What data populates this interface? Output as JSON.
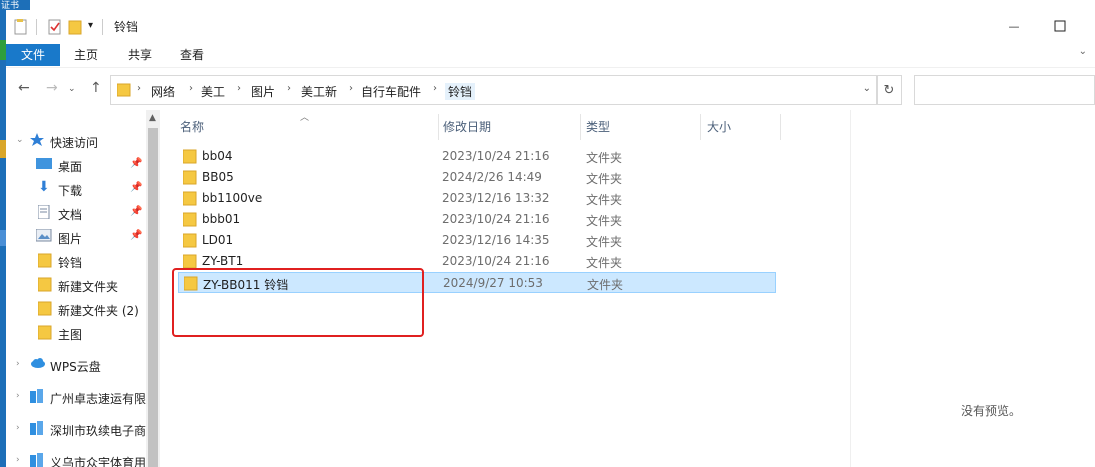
{
  "desktop": {
    "corner_text": "证书"
  },
  "titlebar": {
    "title": "铃铛",
    "maximize_glyph": "☐",
    "minimize_glyph": "—"
  },
  "ribbon": {
    "tabs": [
      {
        "label": "文件",
        "active": true
      },
      {
        "label": "主页",
        "active": false
      },
      {
        "label": "共享",
        "active": false
      },
      {
        "label": "查看",
        "active": false
      }
    ]
  },
  "address": {
    "breadcrumbs": [
      "网络",
      "美工",
      "图片",
      "美工新",
      "自行车配件",
      "铃铛"
    ],
    "search_placeholder": ""
  },
  "nav": {
    "items": [
      {
        "label": "快速访问",
        "icon": "star-icon",
        "pinned": false
      },
      {
        "label": "桌面",
        "icon": "desktop-icon",
        "pinned": true
      },
      {
        "label": "下载",
        "icon": "download-icon",
        "pinned": true
      },
      {
        "label": "文档",
        "icon": "document-icon",
        "pinned": true
      },
      {
        "label": "图片",
        "icon": "pictures-icon",
        "pinned": true
      },
      {
        "label": "铃铛",
        "icon": "folder-icon",
        "pinned": false
      },
      {
        "label": "新建文件夹",
        "icon": "folder-icon",
        "pinned": false
      },
      {
        "label": "新建文件夹 (2)",
        "icon": "folder-icon",
        "pinned": false
      },
      {
        "label": "主图",
        "icon": "folder-icon",
        "pinned": false
      },
      {
        "label": "WPS云盘",
        "icon": "cloud-icon",
        "pinned": false
      },
      {
        "label": "广州卓志速运有限",
        "icon": "org-icon",
        "pinned": false
      },
      {
        "label": "深圳市玖续电子商",
        "icon": "org-icon",
        "pinned": false
      },
      {
        "label": "义乌市众宇体育用",
        "icon": "org-icon",
        "pinned": false
      }
    ]
  },
  "list": {
    "columns": [
      "名称",
      "修改日期",
      "类型",
      "大小"
    ],
    "rows": [
      {
        "name": "bb04",
        "date": "2023/10/24 21:16",
        "type": "文件夹",
        "selected": false
      },
      {
        "name": "BB05",
        "date": "2024/2/26 14:49",
        "type": "文件夹",
        "selected": false
      },
      {
        "name": "bb1100ve",
        "date": "2023/12/16 13:32",
        "type": "文件夹",
        "selected": false
      },
      {
        "name": "bbb01",
        "date": "2023/10/24 21:16",
        "type": "文件夹",
        "selected": false
      },
      {
        "name": "LD01",
        "date": "2023/12/16 14:35",
        "type": "文件夹",
        "selected": false
      },
      {
        "name": "ZY-BT1",
        "date": "2023/10/24 21:16",
        "type": "文件夹",
        "selected": false
      },
      {
        "name": "ZY-BB011 铃铛",
        "date": "2024/9/27 10:53",
        "type": "文件夹",
        "selected": true
      }
    ]
  },
  "preview": {
    "message": "没有预览。"
  },
  "colors": {
    "accent": "#1979ca",
    "selection": "#cce8ff",
    "annotation": "#e02020",
    "folder": "#f5c842"
  }
}
